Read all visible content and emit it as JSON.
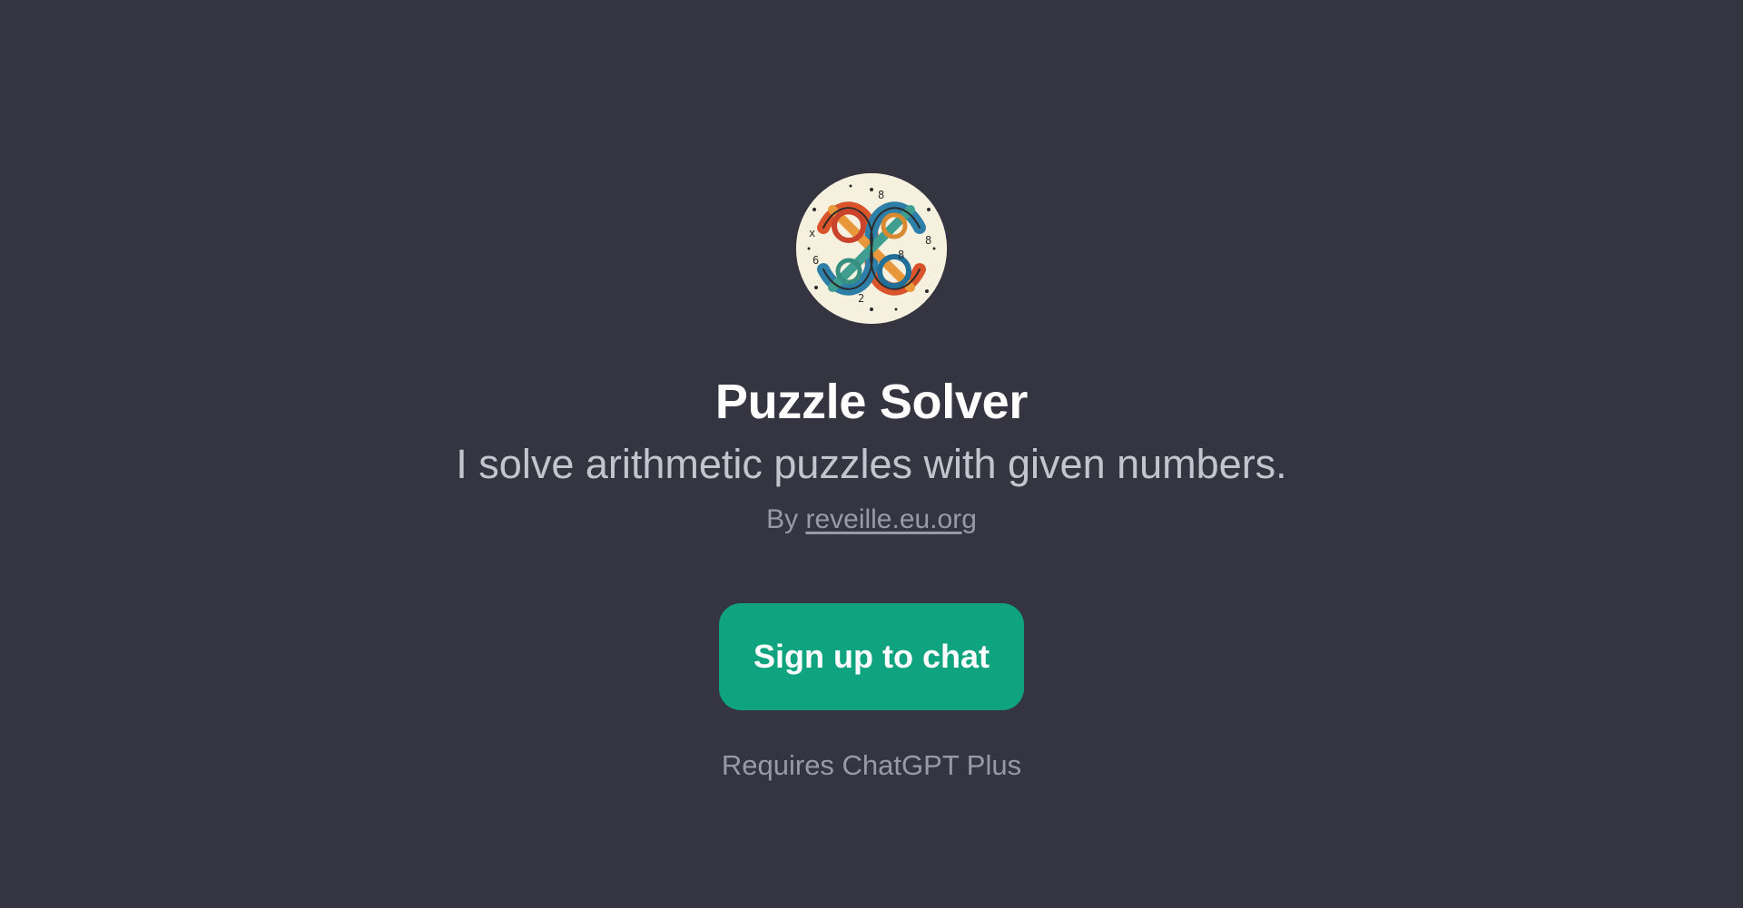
{
  "app": {
    "title": "Puzzle Solver",
    "description": "I solve arithmetic puzzles with given numbers.",
    "byline_prefix": "By",
    "author": "reveille.eu.org",
    "avatar_icon": "knot-puzzle-avatar"
  },
  "actions": {
    "signup_label": "Sign up to chat"
  },
  "footer": {
    "requirement": "Requires ChatGPT Plus"
  },
  "colors": {
    "background": "#353541",
    "accent": "#10a37f",
    "title": "#ffffff",
    "subtitle": "#c4c4ce",
    "muted": "#9a9aa6"
  }
}
